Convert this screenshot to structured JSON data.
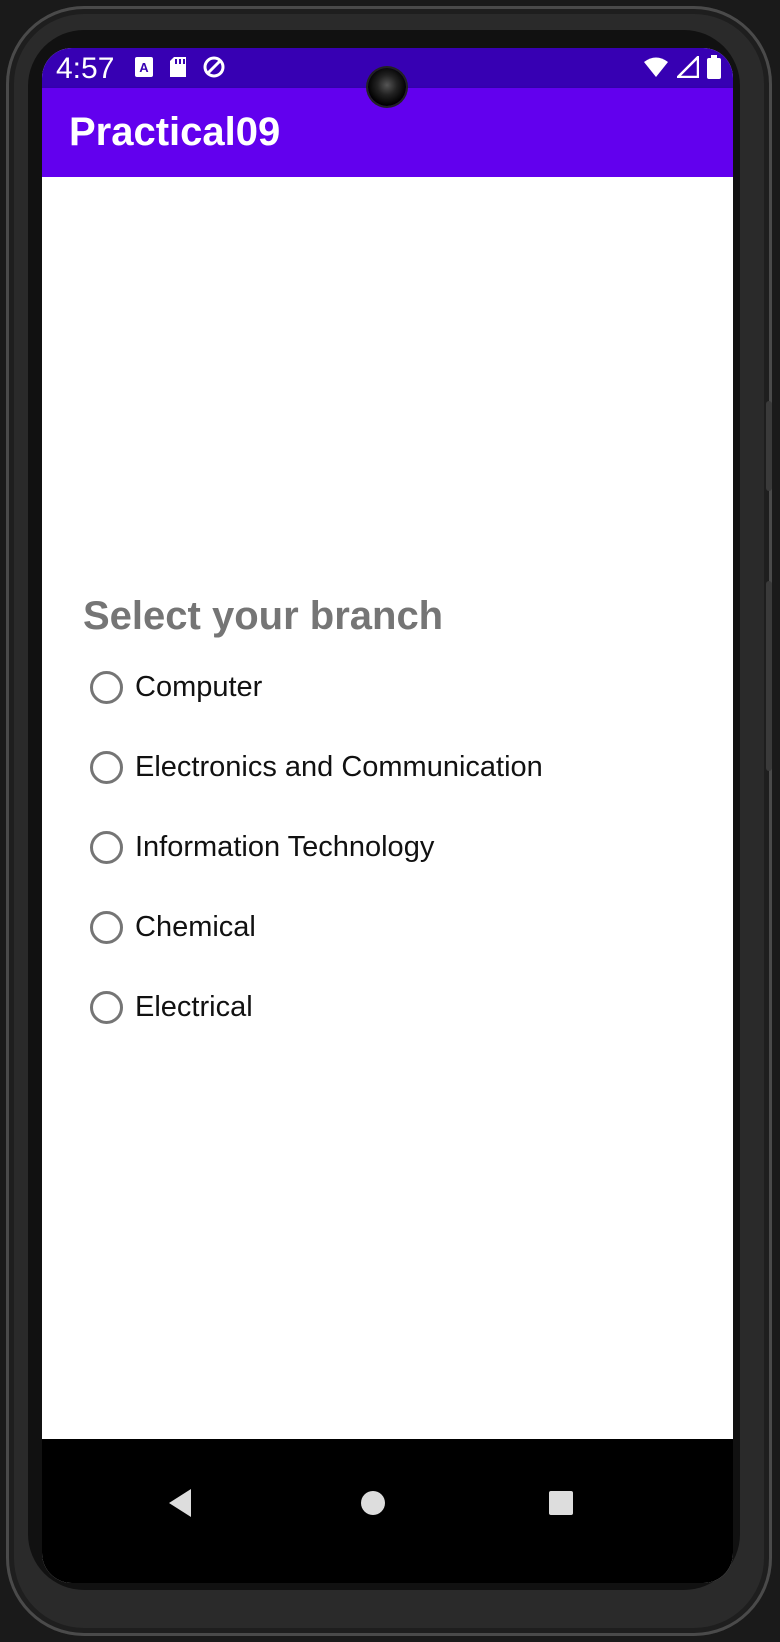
{
  "status_bar": {
    "time": "4:57",
    "left_icons": [
      "a-notification-icon",
      "sd-card-icon",
      "sync-disabled-icon"
    ],
    "right_icons": [
      "wifi-icon",
      "cell-signal-icon",
      "battery-icon"
    ],
    "background": "#3700b3"
  },
  "app_bar": {
    "title": "Practical09",
    "background": "#6200ee"
  },
  "main": {
    "heading": "Select your branch",
    "radio_options": [
      {
        "label": "Computer",
        "checked": false
      },
      {
        "label": "Electronics and Communication",
        "checked": false
      },
      {
        "label": "Information Technology",
        "checked": false
      },
      {
        "label": "Chemical",
        "checked": false
      },
      {
        "label": "Electrical",
        "checked": false
      }
    ]
  },
  "nav_bar": {
    "buttons": [
      "back-icon",
      "home-icon",
      "recents-icon"
    ]
  }
}
